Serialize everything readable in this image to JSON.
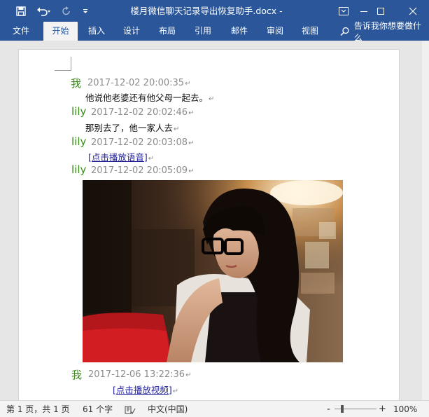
{
  "titlebar": {
    "title": "楼月微信聊天记录导出恢复助手.docx  -",
    "save_icon": "save-icon",
    "undo_icon": "undo-icon",
    "redo_icon": "redo-icon",
    "customize_icon": "customize-quick-access-icon"
  },
  "ribbon": {
    "tabs": [
      "文件",
      "开始",
      "插入",
      "设计",
      "布局",
      "引用",
      "邮件",
      "审阅",
      "视图"
    ],
    "active_tab": "开始",
    "tellme": "告诉我你想要做什么"
  },
  "document": {
    "messages": [
      {
        "sender": "我",
        "time": "2017-12-02 20:00:35",
        "text": "他说他老婆还有他父母一起去。"
      },
      {
        "sender": "lily",
        "time": "2017-12-02 20:02:46",
        "text": "那别去了，他一家人去"
      },
      {
        "sender": "lily",
        "time": "2017-12-02 20:03:08",
        "link": "[点击播放语音]"
      },
      {
        "sender": "lily",
        "time": "2017-12-02 20:05:09"
      },
      {
        "sender": "我",
        "time": "2017-12-06 13:22:36",
        "link": "[点击播放视频]"
      }
    ],
    "paragraph_mark": "↵"
  },
  "statusbar": {
    "page": "第 1 页，共 1 页",
    "words": "61 个字",
    "language": "中文(中国)",
    "zoom": "100%",
    "zoom_minus": "-",
    "zoom_plus": "+"
  },
  "colors": {
    "ribbon_blue": "#2b579a",
    "sender_green": "#3c8a1e",
    "timestamp_gray": "#8c8c8c",
    "link_blue": "#1f1f9a"
  }
}
